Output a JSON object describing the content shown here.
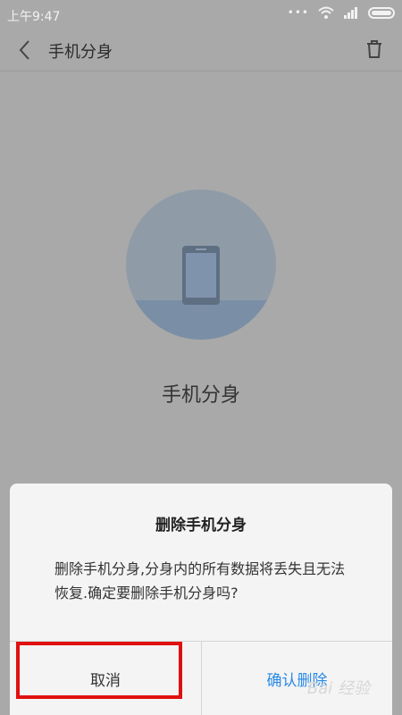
{
  "status_bar": {
    "time": "上午9:47",
    "dots": "•••"
  },
  "header": {
    "title": "手机分身"
  },
  "hero": {
    "title": "手机分身"
  },
  "dialog": {
    "title": "删除手机分身",
    "message": "删除手机分身,分身内的所有数据将丢失且无法恢复.确定要删除手机分身吗?",
    "cancel_label": "取消",
    "confirm_label": "确认删除"
  },
  "watermark": "Bai 经验",
  "colors": {
    "overlay_bg": "#a9a9a9",
    "dialog_bg": "#f4f4f4",
    "confirm_text": "#2a8ae6",
    "highlight": "#e01010",
    "hero_circle": "#8f9ba7"
  },
  "icons": [
    "back-icon",
    "trash-icon",
    "phone-icon",
    "wifi-icon",
    "signal-icon",
    "battery-icon"
  ]
}
